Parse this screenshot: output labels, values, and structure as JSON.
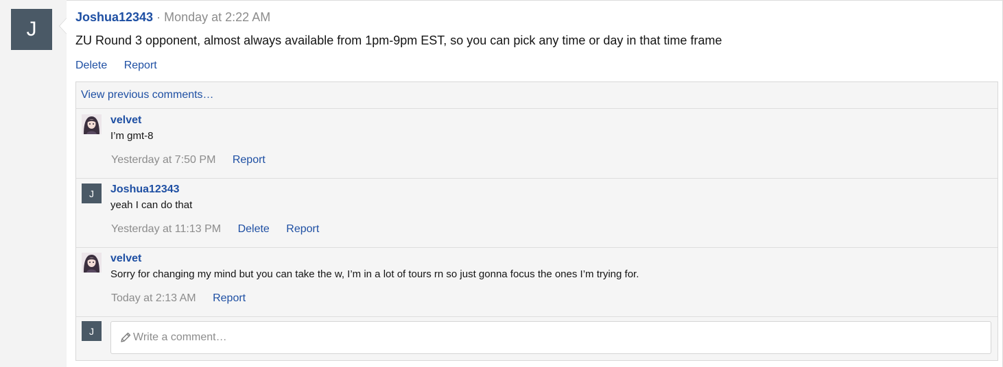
{
  "post": {
    "avatar_letter": "J",
    "author": "Joshua12343",
    "separator": "·",
    "time": "Monday at 2:22 AM",
    "body": "ZU Round 3 opponent, almost always available from 1pm-9pm EST, so you can pick any time or day in that time frame",
    "actions": {
      "delete": "Delete",
      "report": "Report"
    }
  },
  "comments": {
    "view_previous": "View previous comments…",
    "items": [
      {
        "author": "velvet",
        "avatar": "character-portrait",
        "text": "I’m gmt-8",
        "time": "Yesterday at 7:50 PM",
        "report": "Report"
      },
      {
        "author": "Joshua12343",
        "avatar_letter": "J",
        "text": "yeah I can do that",
        "time": "Yesterday at 11:13 PM",
        "delete": "Delete",
        "report": "Report"
      },
      {
        "author": "velvet",
        "avatar": "character-portrait",
        "text": "Sorry for changing my mind but you can take the w, I’m in a lot of tours rn so just gonna focus the ones I’m trying for.",
        "time": "Today at 2:13 AM",
        "report": "Report"
      }
    ],
    "composer": {
      "avatar_letter": "J",
      "placeholder": "Write a comment…",
      "icon": "pencil-icon"
    }
  },
  "colors": {
    "link": "#1e4fa3",
    "avatar_bg": "#4a5966",
    "muted": "#8c8c8c",
    "panel_bg": "#f5f5f5"
  }
}
